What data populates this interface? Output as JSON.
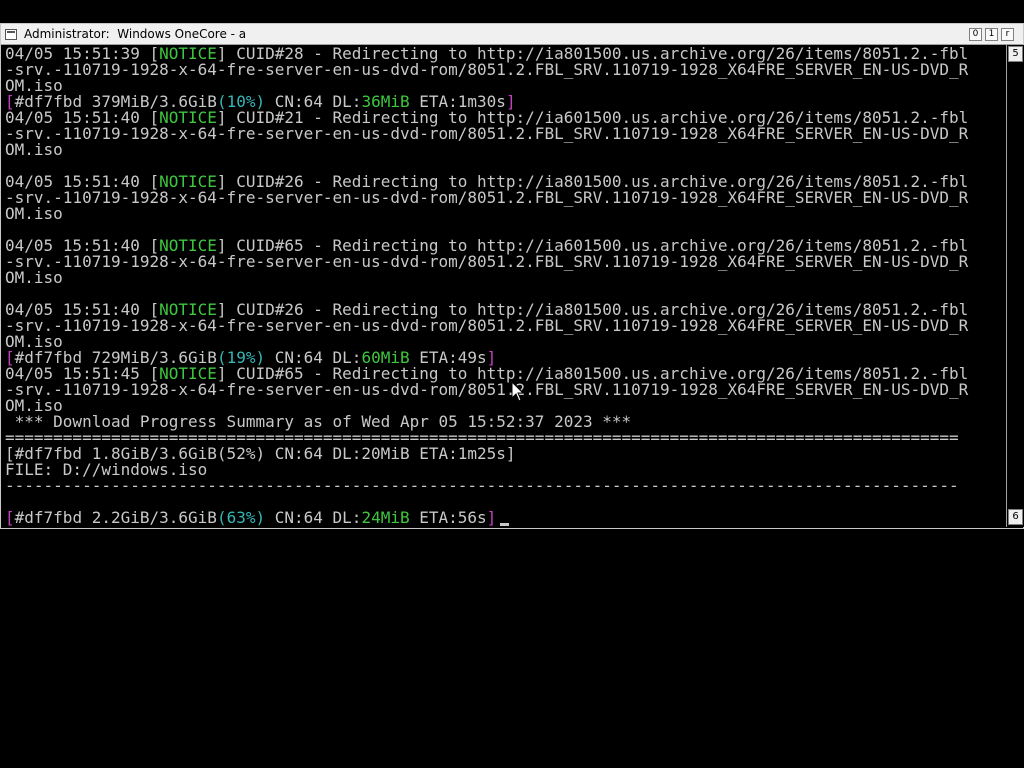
{
  "window": {
    "title": "Administrator:  Windows OneCore - a",
    "controls": {
      "minimize": "0",
      "maximize": "1",
      "close": "r"
    }
  },
  "scrollbar": {
    "top_label": "5",
    "bottom_label": "6"
  },
  "terminal": {
    "lines": [
      {
        "type": "notice",
        "ts": "04/05 15:51:39",
        "cuid": "CUID#28",
        "url_host": "http://ia801500.us.archive.org/26/items/8051.2.-fbl"
      },
      {
        "type": "plain",
        "text": "-srv.-110719-1928-x-64-fre-server-en-us-dvd-rom/8051.2.FBL_SRV.110719-1928_X64FRE_SERVER_EN-US-DVD_R"
      },
      {
        "type": "plain",
        "text": "OM.iso"
      },
      {
        "type": "progress",
        "id": "#df7fbd",
        "size": " 379MiB/3.6GiB",
        "pct": "(10%)",
        "cn": " CN:64 DL:",
        "dl": "36MiB",
        "eta": " ETA:1m30s"
      },
      {
        "type": "notice",
        "ts": "04/05 15:51:40",
        "cuid": "CUID#21",
        "url_host": "http://ia601500.us.archive.org/26/items/8051.2.-fbl"
      },
      {
        "type": "plain",
        "text": "-srv.-110719-1928-x-64-fre-server-en-us-dvd-rom/8051.2.FBL_SRV.110719-1928_X64FRE_SERVER_EN-US-DVD_R"
      },
      {
        "type": "plain",
        "text": "OM.iso"
      },
      {
        "type": "plain",
        "text": ""
      },
      {
        "type": "notice",
        "ts": "04/05 15:51:40",
        "cuid": "CUID#26",
        "url_host": "http://ia801500.us.archive.org/26/items/8051.2.-fbl"
      },
      {
        "type": "plain",
        "text": "-srv.-110719-1928-x-64-fre-server-en-us-dvd-rom/8051.2.FBL_SRV.110719-1928_X64FRE_SERVER_EN-US-DVD_R"
      },
      {
        "type": "plain",
        "text": "OM.iso"
      },
      {
        "type": "plain",
        "text": ""
      },
      {
        "type": "notice",
        "ts": "04/05 15:51:40",
        "cuid": "CUID#65",
        "url_host": "http://ia601500.us.archive.org/26/items/8051.2.-fbl"
      },
      {
        "type": "plain",
        "text": "-srv.-110719-1928-x-64-fre-server-en-us-dvd-rom/8051.2.FBL_SRV.110719-1928_X64FRE_SERVER_EN-US-DVD_R"
      },
      {
        "type": "plain",
        "text": "OM.iso"
      },
      {
        "type": "plain",
        "text": ""
      },
      {
        "type": "notice",
        "ts": "04/05 15:51:40",
        "cuid": "CUID#26",
        "url_host": "http://ia801500.us.archive.org/26/items/8051.2.-fbl"
      },
      {
        "type": "plain",
        "text": "-srv.-110719-1928-x-64-fre-server-en-us-dvd-rom/8051.2.FBL_SRV.110719-1928_X64FRE_SERVER_EN-US-DVD_R"
      },
      {
        "type": "plain",
        "text": "OM.iso"
      },
      {
        "type": "progress",
        "id": "#df7fbd",
        "size": " 729MiB/3.6GiB",
        "pct": "(19%)",
        "cn": " CN:64 DL:",
        "dl": "60MiB",
        "eta": " ETA:49s"
      },
      {
        "type": "notice",
        "ts": "04/05 15:51:45",
        "cuid": "CUID#65",
        "url_host": "http://ia801500.us.archive.org/26/items/8051.2.-fbl"
      },
      {
        "type": "plain",
        "text": "-srv.-110719-1928-x-64-fre-server-en-us-dvd-rom/8051.2.FBL_SRV.110719-1928_X64FRE_SERVER_EN-US-DVD_R"
      },
      {
        "type": "plain",
        "text": "OM.iso"
      },
      {
        "type": "plain",
        "text": " *** Download Progress Summary as of Wed Apr 05 15:52:37 2023 ***"
      },
      {
        "type": "plain",
        "text": "==================================================================================================="
      },
      {
        "type": "plain",
        "text": "[#df7fbd 1.8GiB/3.6GiB(52%) CN:64 DL:20MiB ETA:1m25s]"
      },
      {
        "type": "plain",
        "text": "FILE: D://windows.iso"
      },
      {
        "type": "plain",
        "text": "---------------------------------------------------------------------------------------------------"
      },
      {
        "type": "plain",
        "text": ""
      },
      {
        "type": "progress",
        "id": "#df7fbd",
        "size": " 2.2GiB/3.6GiB",
        "pct": "(63%)",
        "cn": " CN:64 DL:",
        "dl": "24MiB",
        "eta": " ETA:56s",
        "cursor": true
      }
    ],
    "notice_label": "NOTICE",
    "redirect_text": " - Redirecting to "
  },
  "colors": {
    "notice": "#3ec73e",
    "bracket": "#c040c0",
    "percent": "#35b7b7",
    "text": "#c8c8c8",
    "background": "#000000"
  }
}
